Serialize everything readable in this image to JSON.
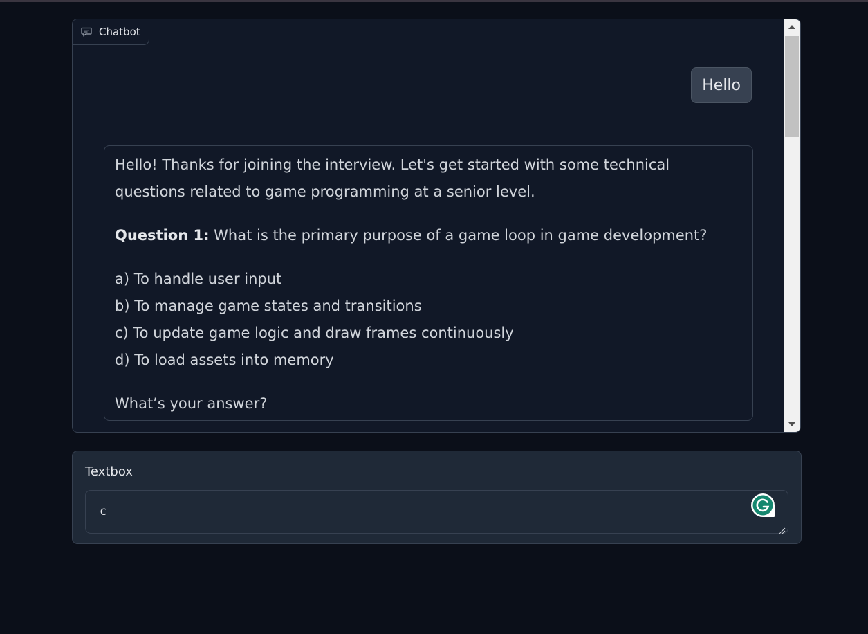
{
  "chatbot": {
    "label": "Chatbot",
    "messages": {
      "user": "Hello",
      "bot": {
        "intro": "Hello! Thanks for joining the interview. Let's get started with some technical questions related to game programming at a senior level.",
        "question_label": "Question 1:",
        "question_text": " What is the primary purpose of a game loop in game development?",
        "options": [
          "a) To handle user input",
          "b) To manage game states and transitions",
          "c) To update game logic and draw frames continuously",
          "d) To load assets into memory"
        ],
        "prompt": "What’s your answer?"
      }
    }
  },
  "textbox": {
    "label": "Textbox",
    "value": "c"
  },
  "icons": {
    "chat": "chat-bubble-icon",
    "grammarly": "grammarly-icon",
    "scroll_up": "scroll-up-arrow-icon",
    "scroll_down": "scroll-down-arrow-icon",
    "resize": "resize-handle-icon"
  },
  "colors": {
    "background": "#0b0f19",
    "panel": "#111827",
    "input_panel": "#1f2937",
    "border": "#374151",
    "grammarly": "#15c39a"
  }
}
